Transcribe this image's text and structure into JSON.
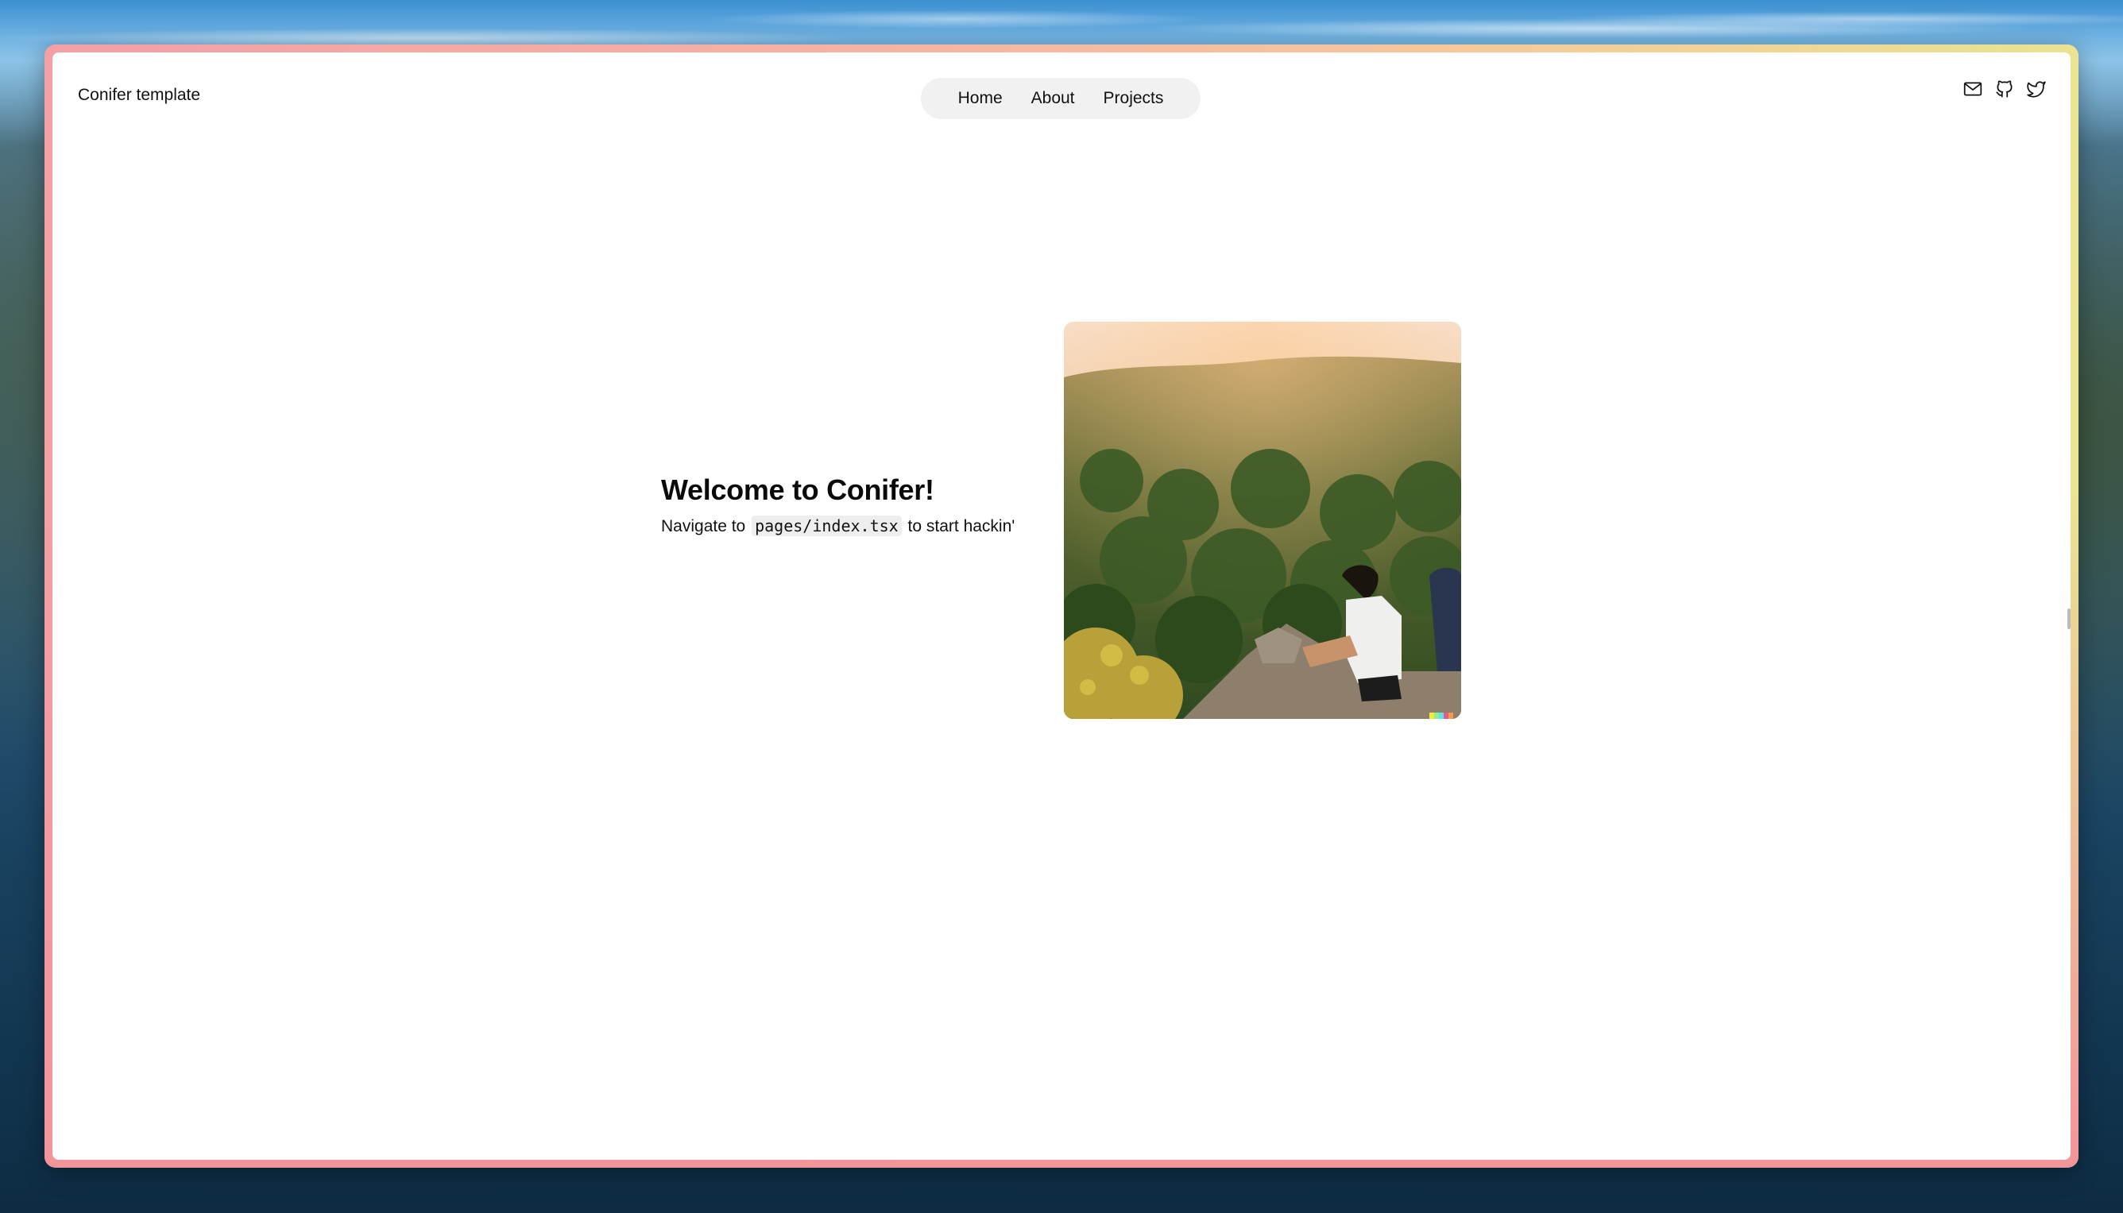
{
  "site": {
    "brand": "Conifer template"
  },
  "nav": {
    "items": [
      {
        "label": "Home"
      },
      {
        "label": "About"
      },
      {
        "label": "Projects"
      }
    ]
  },
  "social": {
    "icons": [
      "mail-icon",
      "github-icon",
      "twitter-icon"
    ]
  },
  "hero": {
    "title": "Welcome to Conifer!",
    "sub_prefix": "Navigate to",
    "code": "pages/index.tsx",
    "sub_suffix": "to start hackin'"
  },
  "colors": {
    "frame_gradient_start": "#f2a0a4",
    "frame_gradient_end": "#e9e393",
    "nav_pill_bg": "#f1f1f2",
    "code_bg": "#eeeeef"
  }
}
